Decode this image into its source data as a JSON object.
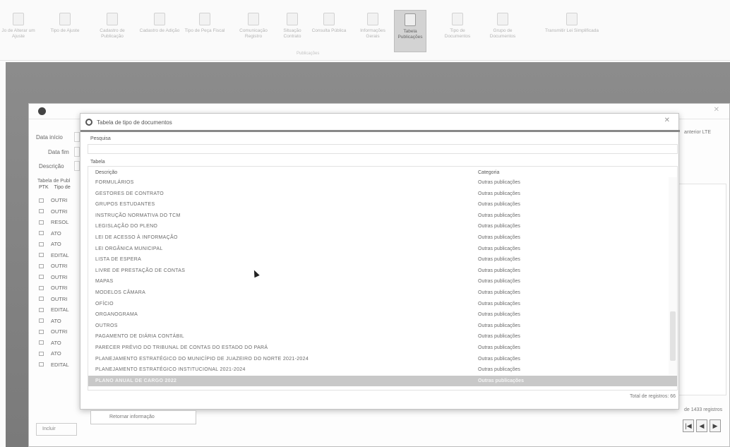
{
  "ribbon": {
    "tabs": [
      "",
      "",
      "",
      ""
    ],
    "buttons": [
      {
        "label": "Jo de Alterar um Ajuste"
      },
      {
        "label": "Tipo de Ajuste"
      },
      {
        "label": "Cadastro de Publicação"
      },
      {
        "label": "Cadastro de Adição"
      },
      {
        "label": "Tipo de Peça Fiscal"
      },
      {
        "label": "Comunicação Registro"
      },
      {
        "label": "Situação Contrato"
      },
      {
        "label": "Consulta Pública"
      },
      {
        "label": "Informações Gerais"
      },
      {
        "label": "Tabela Publicações",
        "active": true
      },
      {
        "label": "Tipo de Documentos"
      },
      {
        "label": "Grupo de Documentos"
      },
      {
        "label": "Transmitir Lei Simplificada"
      }
    ],
    "group_label": "Publicações"
  },
  "main_window": {
    "title": "",
    "labels": {
      "data_inicio": "Data início",
      "data_fim": "Data fim",
      "descricao": "Descrição",
      "tabela": "Tabela de Publ",
      "col_ptk": "PTK",
      "col_tipo": "Tipo de"
    },
    "left_rows": [
      "OUTRI",
      "OUTRI",
      "RESOL",
      "ATO",
      "ATO",
      "EDITAL",
      "OUTRI",
      "OUTRI",
      "OUTRI",
      "OUTRI",
      "EDITAL",
      "ATO",
      "OUTRI",
      "ATO",
      "ATO",
      "EDITAL"
    ],
    "right_label": "anterior LTE",
    "right_count": "de 1433 registros",
    "incluir_label": "Incluir",
    "nav": [
      "|◀",
      "◀",
      "▶"
    ]
  },
  "dialog": {
    "title": "Tabela de tipo de documentos",
    "search_label": "Pesquisa",
    "search_value": "",
    "table_caption": "Tabela",
    "columns": [
      "Descrição",
      "Categoria"
    ],
    "rows": [
      {
        "descricao": "FORMULÁRIOS",
        "categoria": "Outras publicações"
      },
      {
        "descricao": "GESTORES DE CONTRATO",
        "categoria": "Outras publicações"
      },
      {
        "descricao": "GRUPOS ESTUDANTES",
        "categoria": "Outras publicações"
      },
      {
        "descricao": "INSTRUÇÃO NORMATIVA DO TCM",
        "categoria": "Outras publicações"
      },
      {
        "descricao": "LEGISLAÇÃO DO PLENO",
        "categoria": "Outras publicações"
      },
      {
        "descricao": "LEI DE ACESSO À INFORMAÇÃO",
        "categoria": "Outras publicações"
      },
      {
        "descricao": "LEI ORGÂNICA MUNICIPAL",
        "categoria": "Outras publicações"
      },
      {
        "descricao": "LISTA DE ESPERA",
        "categoria": "Outras publicações"
      },
      {
        "descricao": "LIVRE DE PRESTAÇÃO DE CONTAS",
        "categoria": "Outras publicações"
      },
      {
        "descricao": "MAPAS",
        "categoria": "Outras publicações"
      },
      {
        "descricao": "MODELOS CÂMARA",
        "categoria": "Outras publicações"
      },
      {
        "descricao": "OFÍCIO",
        "categoria": "Outras publicações"
      },
      {
        "descricao": "ORGANOGRAMA",
        "categoria": "Outras publicações"
      },
      {
        "descricao": "OUTROS",
        "categoria": "Outras publicações"
      },
      {
        "descricao": "PAGAMENTO DE DIÁRIA CONTÁBIL",
        "categoria": "Outras publicações"
      },
      {
        "descricao": "PARECER PRÉVIO DO TRIBUNAL DE CONTAS DO ESTADO DO PARÁ",
        "categoria": "Outras publicações"
      },
      {
        "descricao": "PLANEJAMENTO ESTRATÉGICO DO MUNICÍPIO DE JUAZEIRO DO NORTE 2021-2024",
        "categoria": "Outras publicações"
      },
      {
        "descricao": "PLANEJAMENTO ESTRATÉGICO INSTITUCIONAL 2021-2024",
        "categoria": "Outras publicações"
      },
      {
        "descricao": "PLANO ANUAL DE CARGO 2022",
        "categoria": "Outras publicações",
        "selected": true
      }
    ],
    "total": "Total de registros: 66",
    "return_button": "Retornar informação"
  }
}
